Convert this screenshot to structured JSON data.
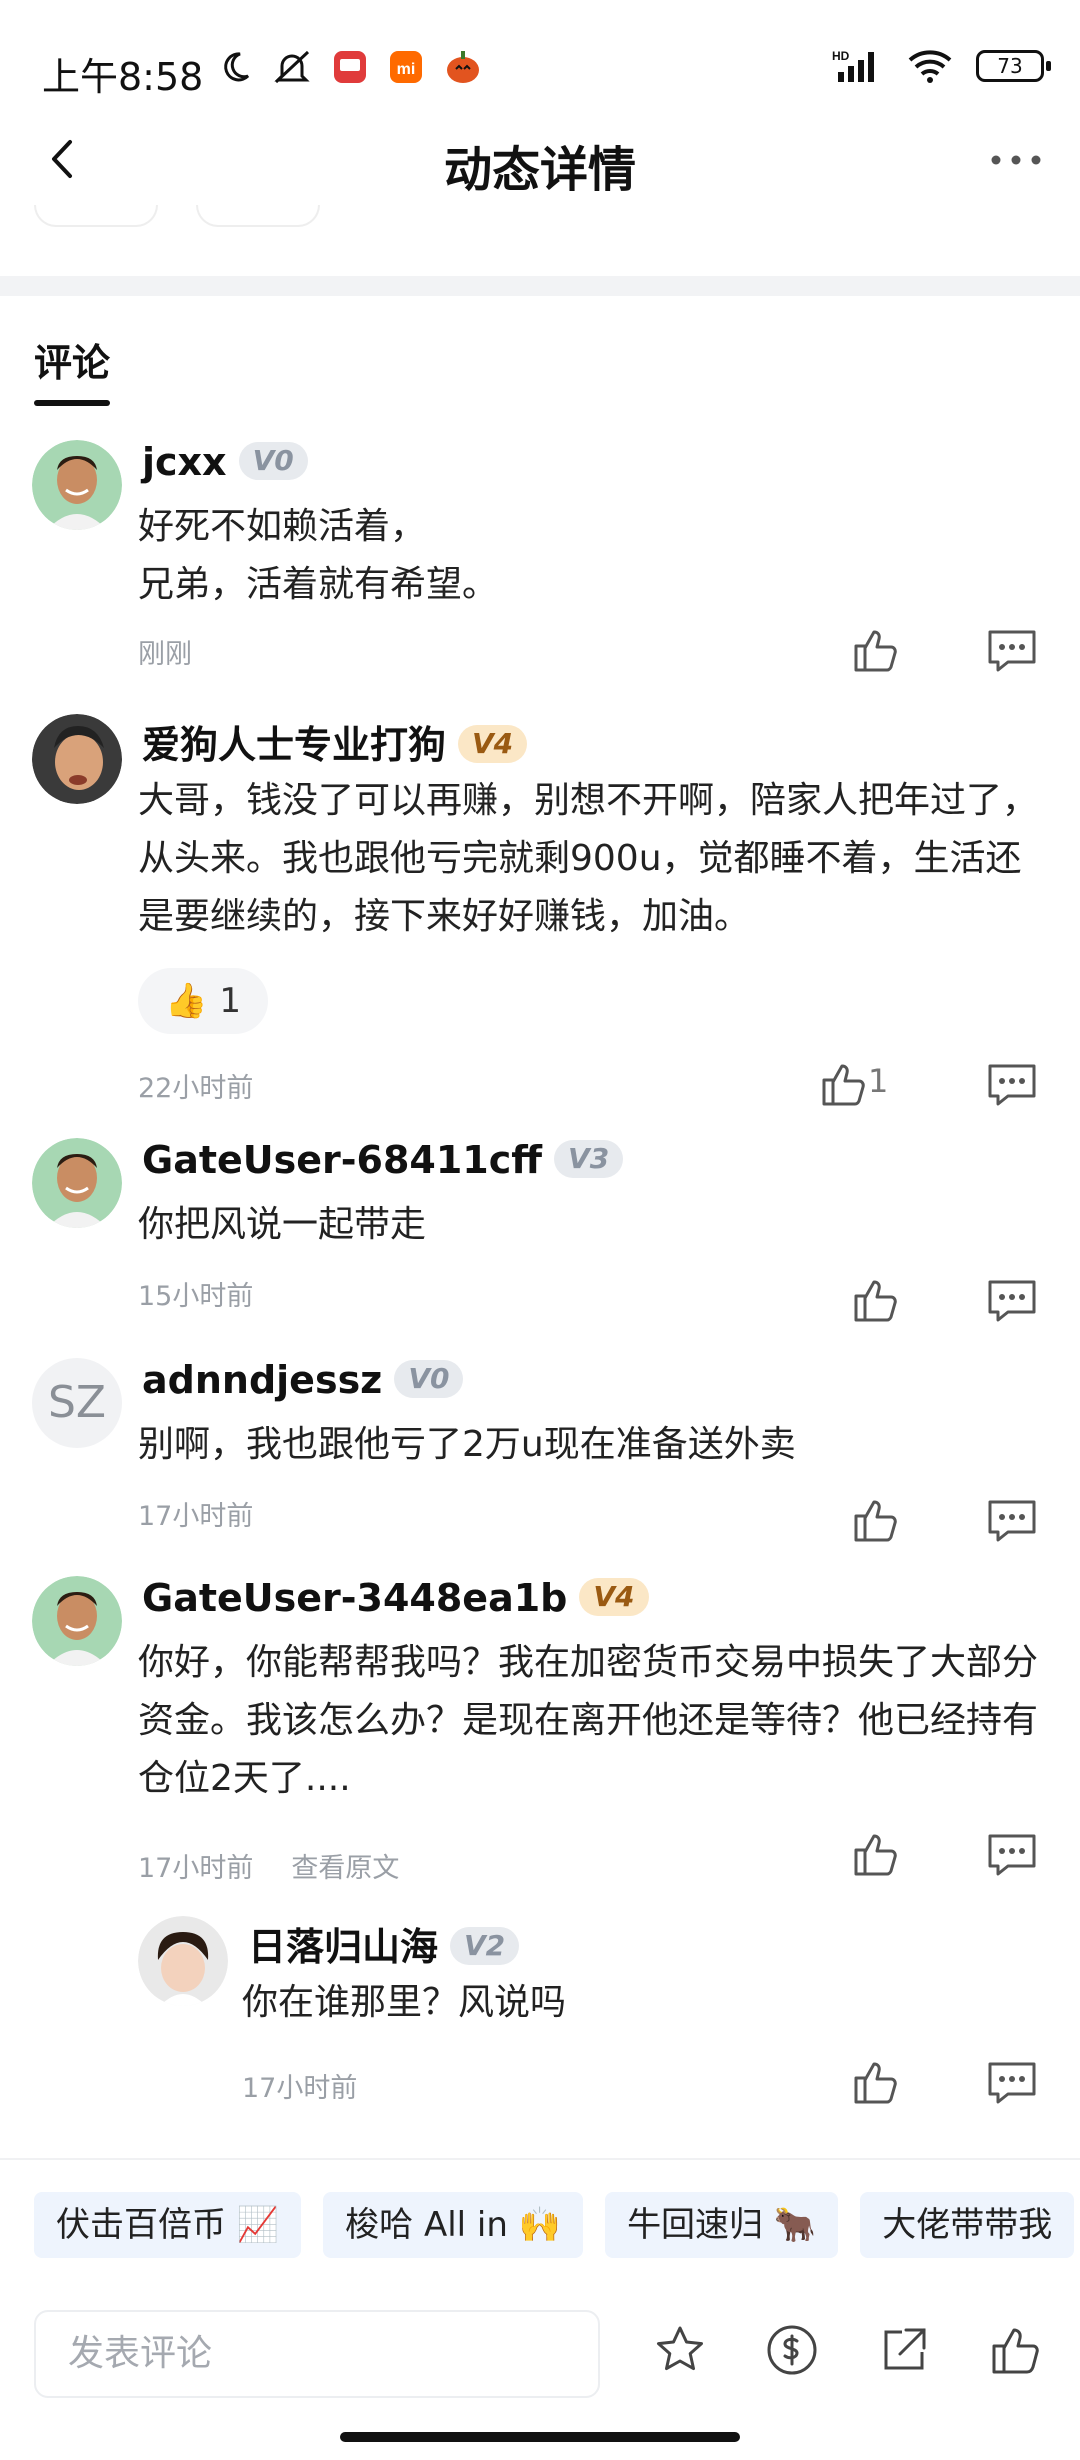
{
  "status_bar": {
    "time": "上午8:58",
    "battery": "73",
    "network": "HD",
    "icons": [
      "moon-icon",
      "mute-icon",
      "app-icon",
      "mi-icon",
      "pumpkin-icon",
      "signal-icon",
      "wifi-icon",
      "battery-icon"
    ]
  },
  "header": {
    "title": "动态详情",
    "back_icon": "chevron-left-icon",
    "more_icon": "more-dots-icon"
  },
  "section": {
    "tab_label": "评论"
  },
  "comments": [
    {
      "user": "jcxx",
      "level": "V0",
      "text": "好死不如赖活着，\n兄弟，活着就有希望。",
      "time": "刚刚",
      "likes": ""
    },
    {
      "user": "爱狗人士专业打狗",
      "level": "V4",
      "text": "大哥，钱没了可以再赚，别想不开啊，陪家人把年过了，从头来。我也跟他亏完就剩900u，觉都睡不着，生活还是要继续的，接下来好好赚钱，加油。",
      "reaction": {
        "emoji": "👍",
        "count": "1"
      },
      "time": "22小时前",
      "likes": "1"
    },
    {
      "user": "GateUser-68411cff",
      "level": "V3",
      "text": "你把风说一起带走",
      "time": "15小时前",
      "likes": ""
    },
    {
      "user": "adnndjessz",
      "level": "V0",
      "avatar_text": "SZ",
      "text": "别啊，我也跟他亏了2万u现在准备送外卖",
      "time": "17小时前",
      "likes": ""
    },
    {
      "user": "GateUser-3448ea1b",
      "level": "V4",
      "text": "你好，你能帮帮我吗？我在加密货币交易中损失了大部分资金。我该怎么办？是现在离开他还是等待？他已经持有仓位2天了....",
      "time": "17小时前",
      "link": "查看原文",
      "likes": ""
    }
  ],
  "reply": {
    "user": "日落归山海",
    "level": "V2",
    "text": "你在谁那里？风说吗",
    "time": "17小时前"
  },
  "quick_replies": [
    "伏击百倍币 📈",
    "梭哈 All in 🙌",
    "牛回速归 🐂",
    "大佬带带我"
  ],
  "composer": {
    "placeholder": "发表评论",
    "icons": [
      "star-icon",
      "tip-coin-icon",
      "share-icon",
      "like-icon"
    ]
  },
  "colors": {
    "level_gray_bg": "#e7eaee",
    "level_gold_bg": "#fbe7c6",
    "quick_chip_bg": "#eef4fd",
    "meta_text": "#9a9fa6"
  }
}
